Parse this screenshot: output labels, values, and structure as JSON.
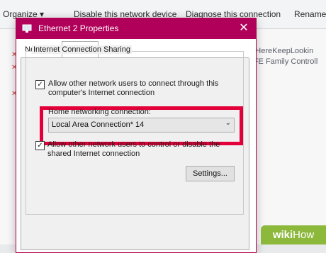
{
  "background_window": {
    "toolbar": {
      "organize_label": "Organize ▾",
      "disable_label": "Disable this network device",
      "diagnose_label": "Diagnose this connection",
      "rename_label": "Rename"
    },
    "right_text_1": "netHereKeepLookin",
    "right_text_2": "re FE Family Controll"
  },
  "dialog": {
    "title": "Ethernet 2 Properties",
    "close_symbol": "✕",
    "tabs": [
      {
        "label": "Networking"
      },
      {
        "label": "Sharing"
      }
    ],
    "group_title": "Internet Connection Sharing",
    "allow_connect_label_1": "Allow other network users to connect through this",
    "allow_connect_label_2": "computer's Internet connection",
    "home_networking_label": "Home networking connection:",
    "home_networking_value": "Local Area Connection* 14",
    "allow_control_label_1": "Allow other network users to control or disable the",
    "allow_control_label_2": "shared Internet connection",
    "settings_label": "Settings..."
  },
  "watermark": {
    "wiki": "wiki",
    "how": "How"
  },
  "colors": {
    "title_bar": "#b0005a",
    "highlight": "#e3003a",
    "watermark": "#8cb83c"
  }
}
